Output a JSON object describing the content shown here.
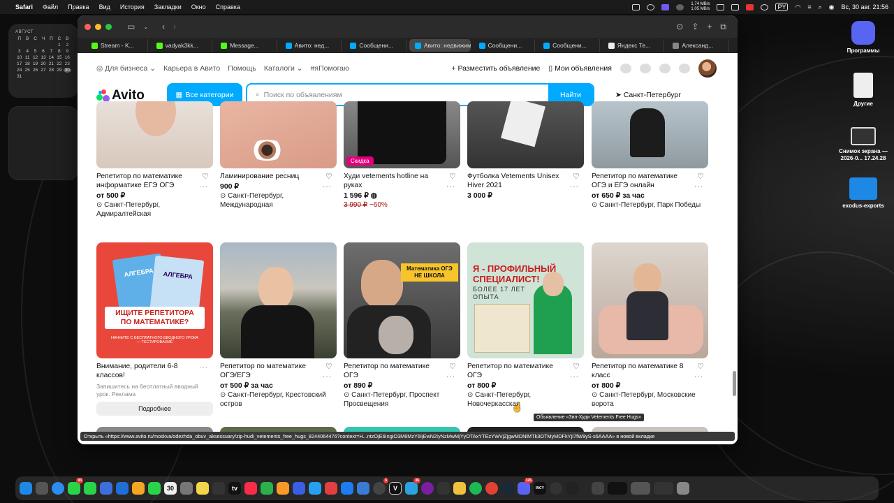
{
  "menubar": {
    "app": "Safari",
    "items": [
      "Файл",
      "Правка",
      "Вид",
      "История",
      "Закладки",
      "Окно",
      "Справка"
    ],
    "net_up": "1,74 MB/s",
    "net_down": "1,05 MB/s",
    "input_lang": "PY",
    "datetime": "Вс, 30 авг.  21:56"
  },
  "calendar": {
    "month": "АВГУСТ",
    "weekdays": [
      "П",
      "В",
      "С",
      "Ч",
      "П",
      "С",
      "В"
    ],
    "days": [
      "",
      "",
      "",
      "",
      "",
      "1",
      "2",
      "3",
      "4",
      "5",
      "6",
      "7",
      "8",
      "9",
      "10",
      "11",
      "12",
      "13",
      "14",
      "15",
      "16",
      "17",
      "18",
      "19",
      "20",
      "21",
      "22",
      "23",
      "24",
      "25",
      "26",
      "27",
      "28",
      "29",
      "30",
      "31"
    ],
    "today": "30"
  },
  "desktop": {
    "icons": [
      {
        "label": "Программы"
      },
      {
        "label": "Другие"
      },
      {
        "label": "Снимок экрана — 2026-0... 17.24.28"
      },
      {
        "label": "exodus-exports"
      }
    ]
  },
  "tabs": [
    {
      "label": "Stream - K...",
      "color": "#53fc18"
    },
    {
      "label": "vadyak3kk...",
      "color": "#53fc18"
    },
    {
      "label": "Message...",
      "color": "#53fc18"
    },
    {
      "label": "Авито: нед...",
      "color": "#00aaff"
    },
    {
      "label": "Сообщени...",
      "color": "#00aaff"
    },
    {
      "label": "Авито: недвижимос...",
      "color": "#00aaff",
      "active": true
    },
    {
      "label": "Сообщени...",
      "color": "#00aaff"
    },
    {
      "label": "Сообщени...",
      "color": "#00aaff"
    },
    {
      "label": "Яндекс Те...",
      "color": "#eeeeee"
    },
    {
      "label": "Александ...",
      "color": "#888888"
    }
  ],
  "topnav": {
    "business": "Для бизнеса",
    "career": "Карьера в Авито",
    "help": "Помощь",
    "catalogs": "Каталоги",
    "helping": "#яПомогаю",
    "post_ad": "Разместить объявление",
    "my_ads": "Мои объявления"
  },
  "header": {
    "logo": "Avito",
    "all_categories": "Все категории",
    "search_placeholder": "Поиск по объявлениям",
    "search_button": "Найти",
    "city": "Санкт-Петербург"
  },
  "row1": [
    {
      "title": "Репетитор по математике информатике ЕГЭ ОГЭ",
      "price": "от 500 ₽",
      "location": "Санкт-Петербург, Адмиралтейская"
    },
    {
      "title": "Ламинирование ресниц",
      "price": "900 ₽",
      "location": "Санкт-Петербург, Международная"
    },
    {
      "title": "Худи vetements hotline на руках",
      "badge": "Скидка",
      "price": "1 596 ₽",
      "old_price": "3 990 ₽",
      "discount": "−60%"
    },
    {
      "title": "Футболка Vetements Unisex Hiver 2021",
      "price": "3 000 ₽"
    },
    {
      "title": "Репетитор по математике ОГЭ и ЕГЭ онлайн",
      "price": "от 650 ₽ за час",
      "location": "Санкт-Петербург, Парк Победы"
    }
  ],
  "ad": {
    "title": "Внимание, родители 6-8 классов!",
    "subtitle": "Запишитесь на бесплатный вводный урок. Реклама",
    "button": "Подробнее",
    "image_text": {
      "line1": "ИЩИТЕ РЕПЕТИТОРА",
      "line2": "ПО МАТЕМАТИКЕ?",
      "line3": "НАЧНИТЕ С БЕСПЛАТНОГО ВВОДНОГО УРОКА — ТЕСТИРОВАНИЕ",
      "book1": "АЛГЕБРА",
      "book2": "АЛГЕБРА"
    }
  },
  "row2": [
    {
      "title": "Репетитор по математике ОГЭ/ЕГЭ",
      "price": "от 500 ₽ за час",
      "location": "Санкт-Петербург, Крестовский остров"
    },
    {
      "title": "Репетитор по математике ОГЭ",
      "price": "от 890 ₽",
      "location": "Санкт-Петербург, Проспект Просвещения",
      "image_text": "Математика ОГЭ НЕ ШКОЛА"
    },
    {
      "title": "Репетитор по математике ОГЭ",
      "price": "от 800 ₽",
      "location": "Санкт-Петербург, Новочеркасская",
      "image_text": {
        "line1": "Я - ПРОФИЛЬНЫЙ",
        "line2": "СПЕЦИАЛИСТ!",
        "line3": "БОЛЕЕ 17 ЛЕТ",
        "line4": "ОПЫТА"
      }
    },
    {
      "title": "Репетитор по математике 8 класс",
      "price": "от 800 ₽",
      "location": "Санкт-Петербург, Московские ворота"
    }
  ],
  "tooltip": "Объявление «Зип-Худи Vetements Free Hugs»",
  "statusbar": "Открыть «https://www.avito.ru/moskva/odezhda_obuv_aksessuary/zip-hudi_vetements_free_hugs_8244064476?context=H...ntzOjE6IngiO3M6MzY6IjEwN2IyNzMwMjYyOTAxYTEzYWVjZjgwMDNlMTk3OTMyMDFkYjI7fW9yS-s6AAAA» в новой вкладке",
  "dock": {
    "calendar_day": "30",
    "appletv": "tv"
  }
}
